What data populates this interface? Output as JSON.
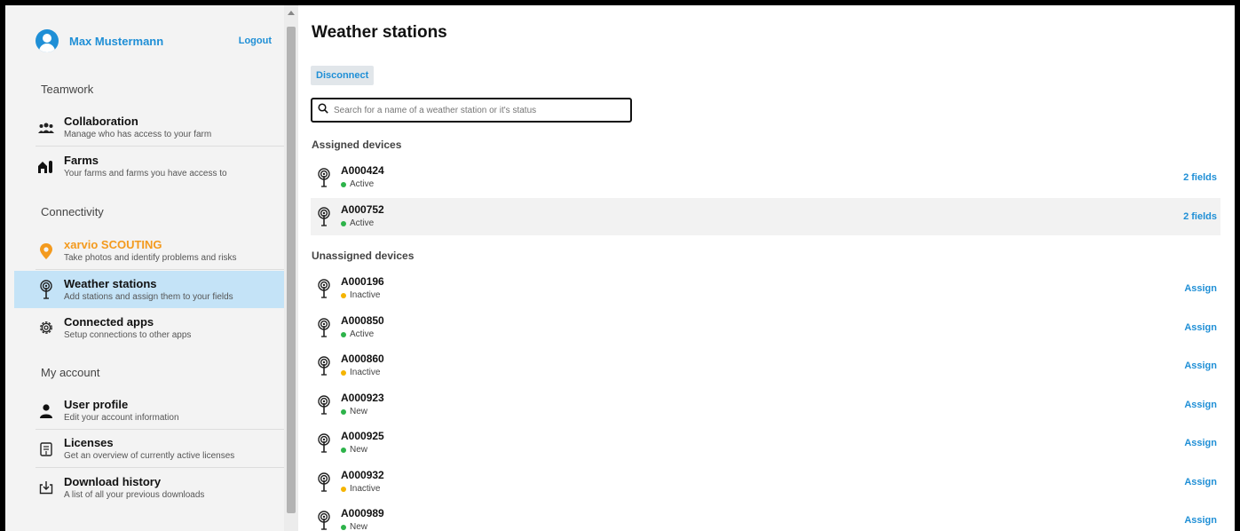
{
  "user": {
    "name": "Max Mustermann",
    "logout_label": "Logout"
  },
  "sections": {
    "teamwork": "Teamwork",
    "connectivity": "Connectivity",
    "my_account": "My account"
  },
  "nav": {
    "collaboration": {
      "title": "Collaboration",
      "sub": "Manage who has access to your farm",
      "icon": "team-icon"
    },
    "farms": {
      "title": "Farms",
      "sub": "Your farms and farms you have access to",
      "icon": "farm-icon"
    },
    "scouting": {
      "title": "xarvio SCOUTING",
      "sub": "Take photos and identify problems and risks",
      "icon": "location-pin-icon"
    },
    "weather": {
      "title": "Weather stations",
      "sub": "Add stations and assign them to your fields",
      "icon": "antenna-icon"
    },
    "apps": {
      "title": "Connected apps",
      "sub": "Setup connections to other apps",
      "icon": "gear-icon"
    },
    "profile": {
      "title": "User profile",
      "sub": "Edit your account information",
      "icon": "user-icon"
    },
    "licenses": {
      "title": "Licenses",
      "sub": "Get an overview of currently active licenses",
      "icon": "license-icon"
    },
    "downloads": {
      "title": "Download history",
      "sub": "A list of all your previous downloads",
      "icon": "download-icon"
    }
  },
  "main": {
    "title": "Weather stations",
    "disconnect_label": "Disconnect",
    "search_placeholder": "Search for a name of a weather station or it's status",
    "assigned_title": "Assigned devices",
    "unassigned_title": "Unassigned devices",
    "assigned": [
      {
        "id": "A000424",
        "status": "Active",
        "action": "2 fields"
      },
      {
        "id": "A000752",
        "status": "Active",
        "action": "2 fields"
      }
    ],
    "unassigned": [
      {
        "id": "A000196",
        "status": "Inactive",
        "action": "Assign"
      },
      {
        "id": "A000850",
        "status": "Active",
        "action": "Assign"
      },
      {
        "id": "A000860",
        "status": "Inactive",
        "action": "Assign"
      },
      {
        "id": "A000923",
        "status": "New",
        "action": "Assign"
      },
      {
        "id": "A000925",
        "status": "New",
        "action": "Assign"
      },
      {
        "id": "A000932",
        "status": "Inactive",
        "action": "Assign"
      },
      {
        "id": "A000989",
        "status": "New",
        "action": "Assign"
      }
    ]
  },
  "colors": {
    "accent": "#1f8fd6",
    "scouting": "#f39a1e",
    "active": "#2db34a",
    "inactive": "#f5b400",
    "new": "#2db34a",
    "selected_bg": "#c4e3f7"
  }
}
